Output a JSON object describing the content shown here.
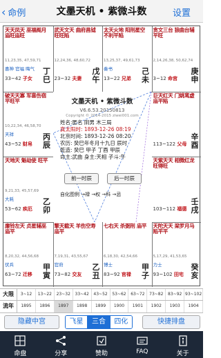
{
  "header": {
    "back_label": "命例",
    "title": "文墨天机 • 紫微斗数",
    "settings_label": "设置"
  },
  "cells": [
    {
      "stars": "天天凤天  巫福阁月  庙旺庙旺",
      "subs": "",
      "ages": "11,23,35, 47,59,71",
      "spirit": "喜神 官福 晦气",
      "range": "33~42",
      "palace": "子女",
      "gz": "丁巳",
      "extra": "病"
    },
    {
      "stars": "武天文天  曲府昌钺  旺旺陷",
      "subs": "",
      "ages": "12,24,36, 48,60,72",
      "spirit": "",
      "range": "23~32",
      "palace": "夫妻",
      "gz": "戊午",
      "extra": "死"
    },
    {
      "stars": "太天火地 阳刑星空  不利平陷",
      "subs": "",
      "ages": "13,25,37, 49,61,73",
      "spirit": "奏书",
      "range": "13~22",
      "palace": "兄弟",
      "gz": "己未",
      "extra": "墓"
    },
    {
      "stars": "贪文三台  狼曲台辅  平旺",
      "subs": "",
      "ages": "2,14,26,38, 50,62,74",
      "spirit": "",
      "range": "3~12",
      "palace": "命宫",
      "gz": "庚申",
      "extra": "绝"
    },
    {
      "stars": "破天天寡  军喜伤宿  平旺平",
      "subs": "",
      "ages": "10,22,34, 46,58,70",
      "spirit": "天祥",
      "range": "43~52",
      "palace": "财帛",
      "gz": "丙辰",
      "extra": "衰"
    },
    {
      "stars": "巨天红天  门姚鸾虚  庙平陷",
      "subs": "",
      "ages": "",
      "spirit": "",
      "range": "113~122",
      "palace": "父母",
      "gz": "辛酉",
      "extra": "胎"
    },
    {
      "stars": "天地天  魁劫使  旺平",
      "subs": "",
      "ages": "9,21,33, 45,57,69",
      "spirit": "大耗",
      "range": "53~62",
      "palace": "疾厄",
      "gz": "乙卯",
      "extra": "帝旺"
    },
    {
      "stars": "天紫天天 相微红龙  旺得旺",
      "subs": "",
      "ages": "",
      "spirit": "",
      "range": "103~112",
      "palace": "福德",
      "gz": "壬戌",
      "extra": "沐浴"
    },
    {
      "stars": "廉铃左天  贞星辅巫  庙平",
      "subs": "",
      "ages": "8,20,32, 44,56,68",
      "spirit": "伏兵",
      "range": "63~72",
      "palace": "迁移",
      "gz": "甲寅",
      "extra": "临官"
    },
    {
      "stars": "擎天截天  羊伤空寿  庙平",
      "subs": "",
      "ages": "7,19,31, 43,55,67",
      "spirit": "官府",
      "range": "73~82",
      "palace": "交友",
      "gz": "乙丑",
      "extra": "冠带"
    },
    {
      "stars": "七右天  杀弼刑  庙平",
      "subs": "",
      "ages": "6,18,30, 42,54,66",
      "spirit": "博士",
      "range": "83~92",
      "palace": "官禄",
      "gz": "甲子",
      "extra": "沐浴"
    },
    {
      "stars": "天陀天天  梁罗月马  陷平平",
      "subs": "",
      "ages": "5,17,29, 41,53,65",
      "spirit": "力士",
      "range": "93~102",
      "palace": "田宅",
      "gz": "癸亥",
      "extra": "长生"
    }
  ],
  "center": {
    "title": "文墨天机 • 紫微斗数",
    "version": "V6.6.53.20150813",
    "copyright": "Copyright © 2014-2015 ziwei001.com",
    "lines": [
      "姓名:匿名    阴男  木三局",
      "真太阳时: 1893-12-26  08:19",
      "北京时间: 1893-12-26  08:20",
      "农历: 癸巳年冬月十九日 辰时",
      "乾造: 癸巳  甲子  丁酉  甲辰",
      "命主:武曲  身主:天相  子斗:午"
    ],
    "prev_label": "前一时辰",
    "next_label": "后一时辰",
    "legend": "自化图例 →禄 →权 →科 →忌"
  },
  "limits": {
    "row1_header": "大限",
    "row1": [
      "3~12",
      "13~22",
      "23~32",
      "33~42",
      "43~52",
      "53~62",
      "63~72",
      "73~82",
      "83~92",
      "93~102"
    ],
    "row2_header": "流年",
    "row2": [
      "1895",
      "1896",
      "1897",
      "1898",
      "1899",
      "1900",
      "1901",
      "1902",
      "1903",
      "1904"
    ]
  },
  "actions": {
    "hide_label": "隐藏中宫",
    "seg": [
      "飞星",
      "三合",
      "四化"
    ],
    "seg_active": 1,
    "quick_label": "快捷排盘"
  },
  "tabs": [
    {
      "label": "命盘",
      "icon": "chart-icon"
    },
    {
      "label": "分享",
      "icon": "share-icon"
    },
    {
      "label": "赞助",
      "icon": "donate-icon"
    },
    {
      "label": "FAQ",
      "icon": "faq-icon"
    },
    {
      "label": "关于",
      "icon": "about-icon"
    }
  ]
}
